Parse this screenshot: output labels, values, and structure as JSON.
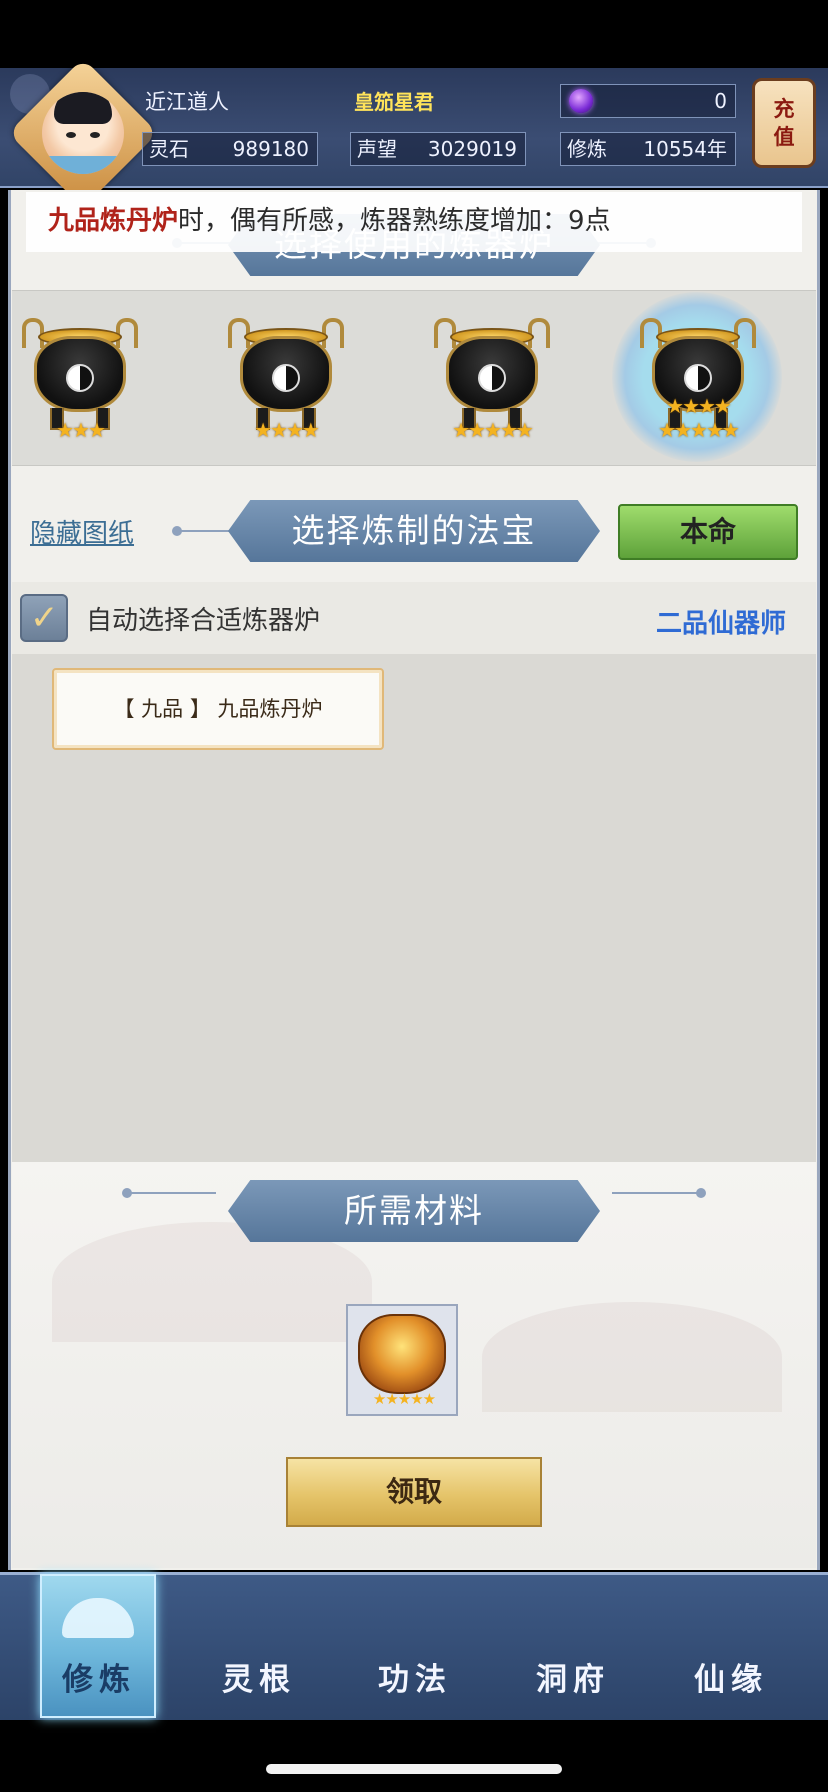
{
  "header": {
    "player_name": "近江道人",
    "player_title": "皇笳星君",
    "gem_value": "0",
    "recharge_label": [
      "充",
      "值"
    ],
    "stats": [
      {
        "label": "灵石",
        "value": "989180"
      },
      {
        "label": "声望",
        "value": "3029019"
      },
      {
        "label": "修炼",
        "value": "10554年"
      }
    ]
  },
  "notice": {
    "highlight": "九品炼丹炉",
    "text": "时，偶有所感，炼器熟练度增加：9点"
  },
  "furnace_section": {
    "title": "选择使用的炼器炉",
    "furnaces": [
      {
        "stars": 3,
        "star_text": "★★★",
        "selected": false
      },
      {
        "stars": 4,
        "star_text": "★★★★",
        "selected": false
      },
      {
        "stars": 5,
        "star_text": "★★★★★",
        "selected": false
      },
      {
        "stars": 8,
        "star_text_top": "★★★★",
        "star_text_bottom": "★★★★★",
        "selected": true
      }
    ]
  },
  "treasure_section": {
    "hide_link": "隐藏图纸",
    "title": "选择炼制的法宝",
    "bonus_button": "本命",
    "auto_select_label": "自动选择合适炼器炉",
    "auto_select_checked": true,
    "rank_label": "二品仙器师",
    "recipes": [
      {
        "label": "【 九品 】 九品炼丹炉"
      }
    ]
  },
  "materials_section": {
    "title": "所需材料",
    "item_stars": "★★★★★",
    "claim_button": "领取"
  },
  "bottom_nav": {
    "active_index": 0,
    "items": [
      {
        "label": "修炼"
      },
      {
        "label": "灵根"
      },
      {
        "label": "功法"
      },
      {
        "label": "洞府"
      },
      {
        "label": "仙缘"
      }
    ]
  },
  "colors": {
    "accent_blue": "#2f6bd4",
    "notice_highlight": "#b0231a",
    "star_gold": "#f4b320",
    "bonus_green": "#5ea23a"
  }
}
